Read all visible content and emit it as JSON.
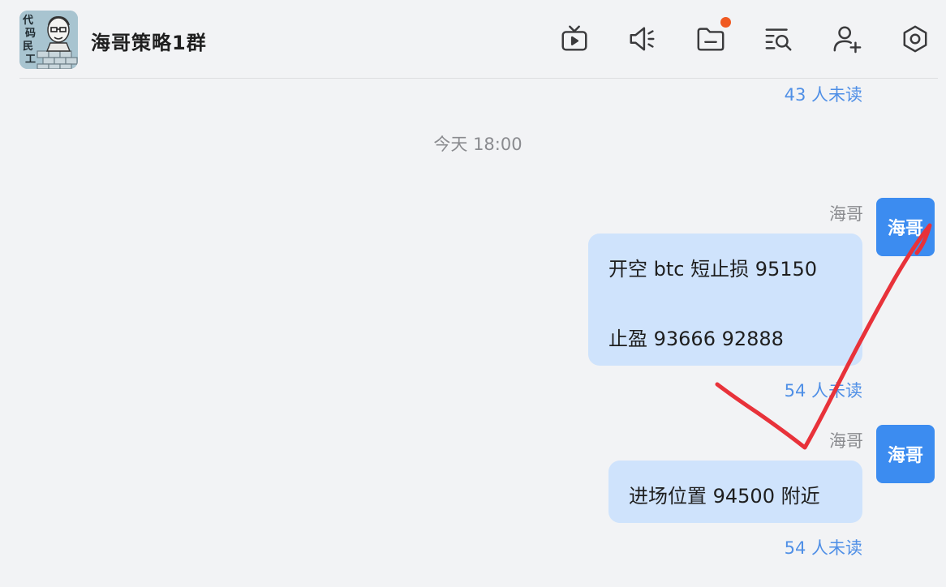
{
  "header": {
    "title": "海哥策略1群",
    "avatar_text": "代码民工",
    "icons": [
      "tv-icon",
      "speaker-icon",
      "folder-icon",
      "search-history-icon",
      "add-member-icon",
      "settings-icon"
    ],
    "notification_color": "#f05a22"
  },
  "chat": {
    "top_read_status": "43 人未读",
    "timestamp": "今天 18:00",
    "messages": [
      {
        "sender": "海哥",
        "avatar_label": "海哥",
        "lines": [
          "开空 btc 短止损 95150",
          "止盈 93666 92888"
        ],
        "read_status": "54 人未读"
      },
      {
        "sender": "海哥",
        "avatar_label": "海哥",
        "lines": [
          "进场位置 94500 附近"
        ],
        "read_status": "54 人未读"
      }
    ]
  },
  "colors": {
    "bubble": "#cfe3fc",
    "avatar": "#3c8cf0",
    "read_status": "#4f8fe6",
    "annotation": "#e8323a"
  }
}
